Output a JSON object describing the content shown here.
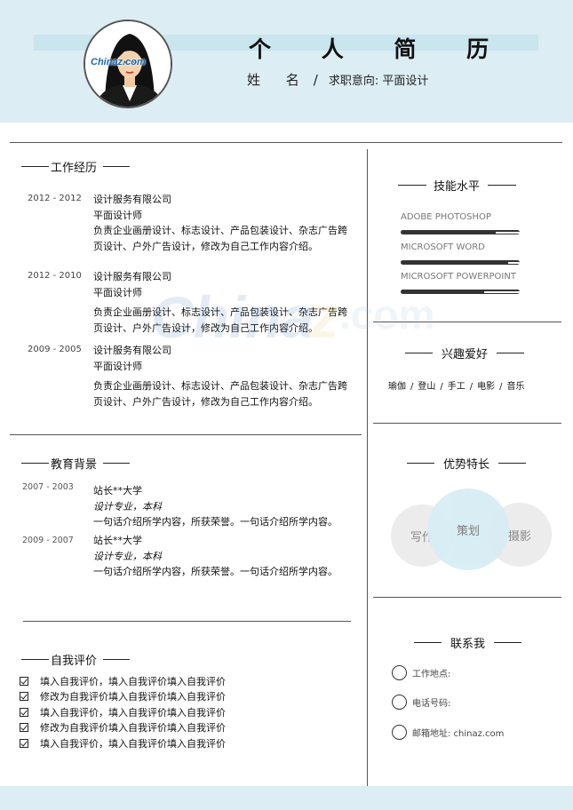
{
  "header": {
    "title": "个 人 简 历",
    "name_label": "姓 名",
    "slash": "/",
    "job_intent": "求职意向: 平面设计",
    "avatar_logo_text": "Chinaz.com"
  },
  "work": {
    "heading": "工作经历",
    "items": [
      {
        "date": "2012 - 2012",
        "company": "设计服务有限公司",
        "role": "平面设计师",
        "desc": "负责企业画册设计、标志设计、产品包装设计、杂志广告跨页设计、户外广告设计，修改为自己工作内容介绍。"
      },
      {
        "date": "2012 - 2010",
        "company": "设计服务有限公司",
        "role": "平面设计师",
        "desc": "负责企业画册设计、标志设计、产品包装设计、杂志广告跨页设计、户外广告设计，修改为自己工作内容介绍。"
      },
      {
        "date": "2009 - 2005",
        "company": "设计服务有限公司",
        "role": "平面设计师",
        "desc": "负责企业画册设计、标志设计、产品包装设计、杂志广告跨页设计、户外广告设计，修改为自己工作内容介绍。"
      }
    ]
  },
  "education": {
    "heading": "教育背景",
    "items": [
      {
        "date": "2007 - 2003",
        "school": "站长**大学",
        "major": "设计专业，本科",
        "desc": "一句话介绍所学内容，所获荣誉。一句话介绍所学内容。"
      },
      {
        "date": "2009 - 2007",
        "school": "站长**大学",
        "major": "设计专业，本科",
        "desc": "一句话介绍所学内容，所获荣誉。一句话介绍所学内容。"
      }
    ]
  },
  "self_eval": {
    "heading": "自我评价",
    "items": [
      "填入自我评价，填入自我评价填入自我评价",
      "修改为自我评价填入自我评价填入自我评价",
      "填入自我评价，填入自我评价填入自我评价",
      "修改为自我评价填入自我评价填入自我评价",
      "填入自我评价，填入自我评价填入自我评价"
    ]
  },
  "skills": {
    "heading": "技能水平",
    "items": [
      {
        "name": "ADOBE PHOTOSHOP",
        "level": 0.8
      },
      {
        "name": "MICROSOFT WORD",
        "level": 0.9
      },
      {
        "name": "MICROSOFT POWERPOINT",
        "level": 0.7
      }
    ]
  },
  "hobbies": {
    "heading": "兴趣爱好",
    "items": [
      "瑜伽",
      "登山",
      "手工",
      "电影",
      "音乐"
    ],
    "separator": "/"
  },
  "strengths": {
    "heading": "优势特长",
    "left": "写作",
    "middle": "策划",
    "right": "摄影"
  },
  "contact": {
    "heading": "联系我",
    "work_place": "工作地点:",
    "phone": "电话号码:",
    "email": "邮箱地址: chinaz.com"
  },
  "colors": {
    "band": "#dcedf3",
    "accent_circle": "#d8edf4"
  }
}
